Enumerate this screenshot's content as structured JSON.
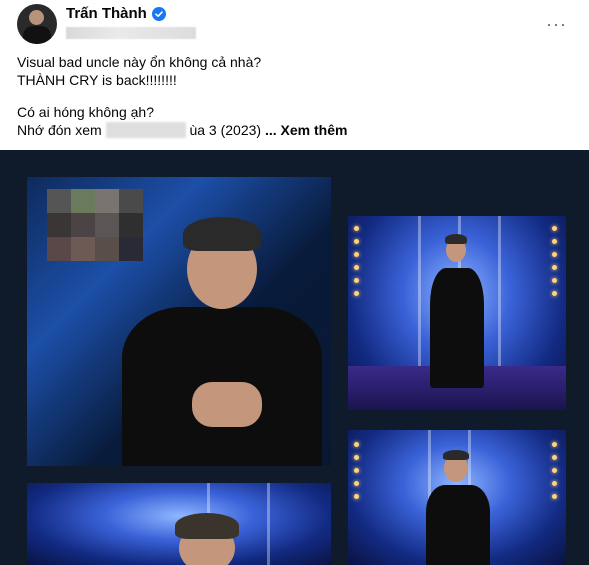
{
  "post": {
    "author": "Trấn Thành",
    "text_line1": "Visual bad uncle này ổn không cả nhà?",
    "text_line2": "THÀNH CRY is back!!!!!!!!",
    "text_line3": "Có ai hóng không ạh?",
    "text_line4_start": "Nhớ đón xem",
    "text_line4_end": "ùa 3 (2023)",
    "see_more": "... Xem thêm",
    "more_options": "···"
  },
  "colors": {
    "verified": "#1877f2",
    "secondary_text": "#65676b",
    "media_background": "#0f1a2a"
  },
  "icons": {
    "verified": "verified-badge-icon",
    "more": "more-options-icon"
  }
}
